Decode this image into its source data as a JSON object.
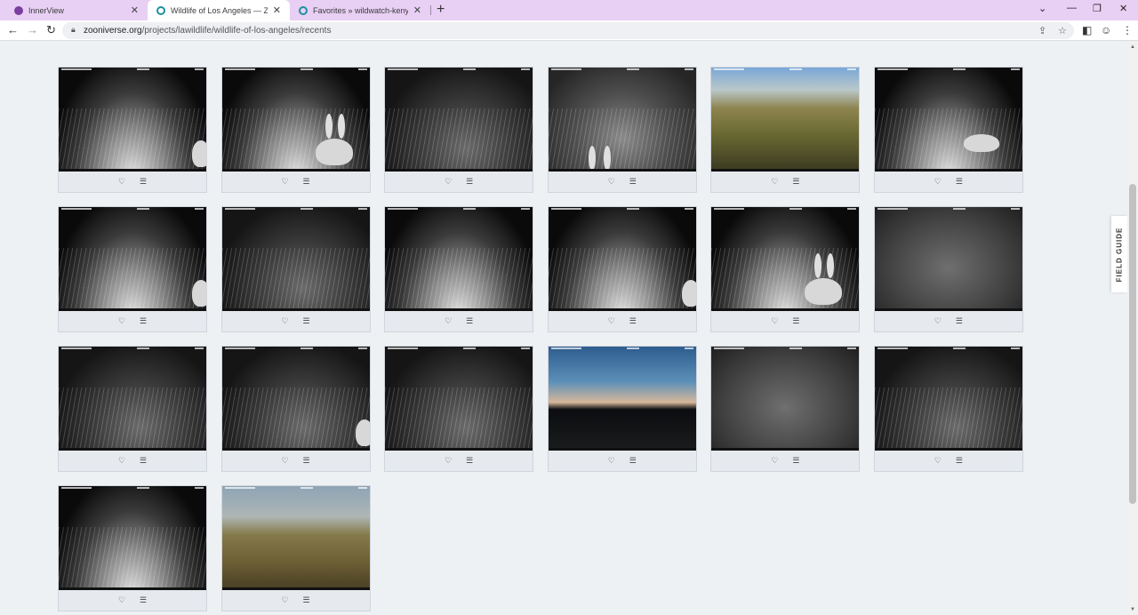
{
  "browser": {
    "tabs": [
      {
        "title": "InnerView",
        "active": false
      },
      {
        "title": "Wildlife of Los Angeles — Zooniverse",
        "active": true
      },
      {
        "title": "Favorites » wildwatch-kenya — Zooniverse",
        "active": false
      }
    ],
    "url_host": "zooniverse.org",
    "url_path": "/projects/lawildlife/wildlife-of-los-angeles/recents"
  },
  "field_guide_label": "FIELD GUIDE",
  "icons": {
    "favorite": "heart-icon",
    "collect": "list-icon"
  },
  "subjects": [
    {
      "scene": "night1",
      "animal": "rabbit-edge"
    },
    {
      "scene": "night1",
      "animal": "rabbit"
    },
    {
      "scene": "night2",
      "animal": "none"
    },
    {
      "scene": "night3",
      "animal": "rabbit-ears"
    },
    {
      "scene": "day1",
      "animal": "none"
    },
    {
      "scene": "night1",
      "animal": "rabbit-small"
    },
    {
      "scene": "night1",
      "animal": "rabbit-edge"
    },
    {
      "scene": "night2",
      "animal": "none"
    },
    {
      "scene": "night1",
      "animal": "none"
    },
    {
      "scene": "night1",
      "animal": "rabbit-edge"
    },
    {
      "scene": "night1",
      "animal": "rabbit"
    },
    {
      "scene": "fog",
      "animal": "none"
    },
    {
      "scene": "night2",
      "animal": "none"
    },
    {
      "scene": "night2",
      "animal": "rabbit-edge"
    },
    {
      "scene": "night2",
      "animal": "none"
    },
    {
      "scene": "dusk",
      "animal": "none"
    },
    {
      "scene": "fog",
      "animal": "none"
    },
    {
      "scene": "night2",
      "animal": "none"
    },
    {
      "scene": "night1",
      "animal": "none"
    },
    {
      "scene": "day2",
      "animal": "none"
    }
  ]
}
